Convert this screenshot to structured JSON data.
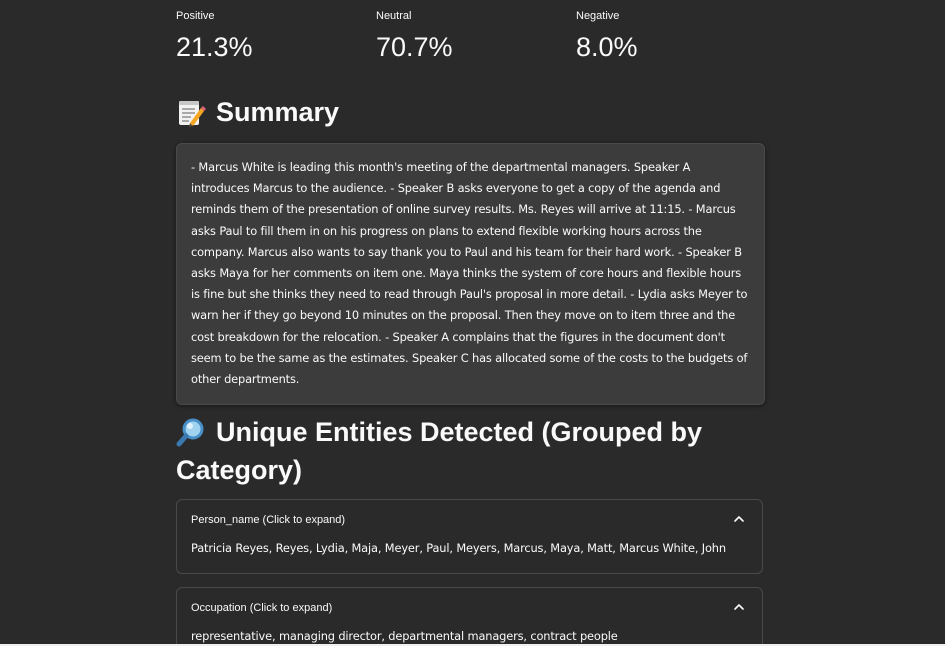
{
  "metrics": [
    {
      "label": "Positive",
      "value": "21.3%"
    },
    {
      "label": "Neutral",
      "value": "70.7%"
    },
    {
      "label": "Negative",
      "value": "8.0%"
    }
  ],
  "summary": {
    "icon": "memo-icon",
    "title": "Summary",
    "text": "- Marcus White is leading this month's meeting of the departmental managers. Speaker A introduces Marcus to the audience. - Speaker B asks everyone to get a copy of the agenda and reminds them of the presentation of online survey results. Ms. Reyes will arrive at 11:15. - Marcus asks Paul to fill them in on his progress on plans to extend flexible working hours across the company. Marcus also wants to say thank you to Paul and his team for their hard work. - Speaker B asks Maya for her comments on item one. Maya thinks the system of core hours and flexible hours is fine but she thinks they need to read through Paul's proposal in more detail. - Lydia asks Meyer to warn her if they go beyond 10 minutes on the proposal. Then they move on to item three and the cost breakdown for the relocation. - Speaker A complains that the figures in the document don't seem to be the same as the estimates. Speaker C has allocated some of the costs to the budgets of other departments."
  },
  "entities": {
    "icon": "magnifying-glass-icon",
    "title": "Unique Entities Detected (Grouped by Category)",
    "groups": [
      {
        "title": "Person_name (Click to expand)",
        "content": "Patricia Reyes, Reyes, Lydia, Maja, Meyer, Paul, Meyers, Marcus, Maya, Matt, Marcus White, John"
      },
      {
        "title": "Occupation (Click to expand)",
        "content": "representative, managing director, departmental managers, contract people"
      }
    ]
  },
  "colors": {
    "background": "#2a2a2a",
    "surface": "#3c3c3c",
    "border": "#4a4a4a",
    "text": "#fafafa"
  }
}
